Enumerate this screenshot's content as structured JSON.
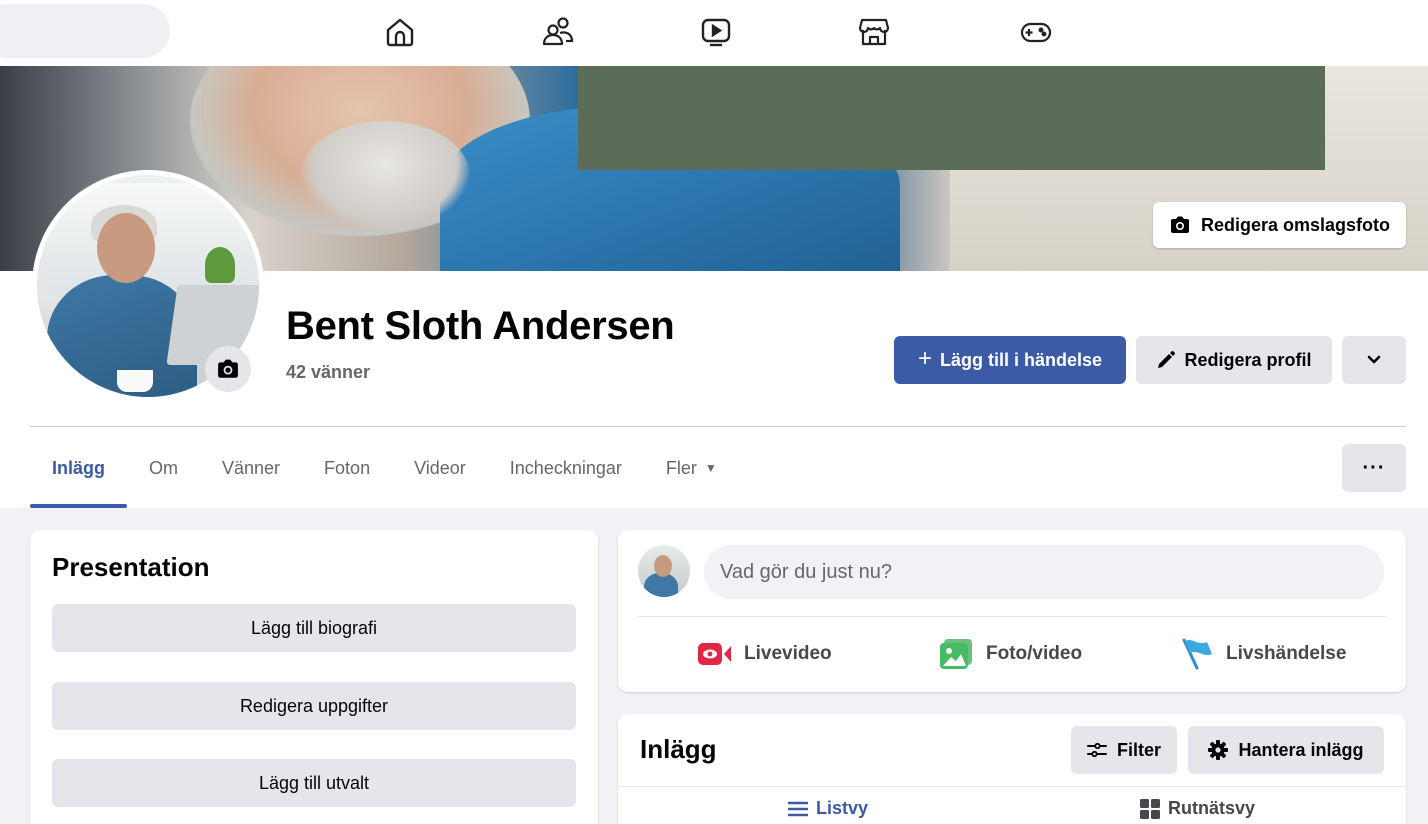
{
  "profile": {
    "name": "Bent Sloth Andersen",
    "friends": "42 vänner"
  },
  "header": {
    "edit_cover_label": "Redigera omslagsfoto",
    "add_event_label": "Lägg till i händelse",
    "edit_profile_label": "Redigera profil"
  },
  "tabs": [
    "Inlägg",
    "Om",
    "Vänner",
    "Foton",
    "Videor",
    "Incheckningar",
    "Fler"
  ],
  "tabs_more_caret": "▼",
  "more_button": "···",
  "intro": {
    "title": "Presentation",
    "buttons": [
      "Lägg till biografi",
      "Redigera uppgifter",
      "Lägg till utvalt"
    ]
  },
  "composer": {
    "placeholder": "Vad gör du just nu?",
    "actions": [
      "Livevideo",
      "Foto/video",
      "Livshändelse"
    ]
  },
  "posts": {
    "title": "Inlägg",
    "filter_label": "Filter",
    "manage_label": "Hantera inlägg",
    "list_view_label": "Listvy",
    "grid_view_label": "Rutnätsvy"
  },
  "colors": {
    "accent": "#3b5ba6",
    "button_gray": "#e4e6eb",
    "cover_green": "#5b6c59"
  },
  "icons": [
    "home-icon",
    "friends-icon",
    "video-icon",
    "marketplace-icon",
    "gaming-icon",
    "camera-icon",
    "pencil-icon",
    "plus-icon",
    "chevron-down-icon",
    "live-video-icon",
    "photo-icon",
    "flag-icon",
    "filter-icon",
    "gear-icon",
    "list-icon",
    "grid-icon"
  ]
}
